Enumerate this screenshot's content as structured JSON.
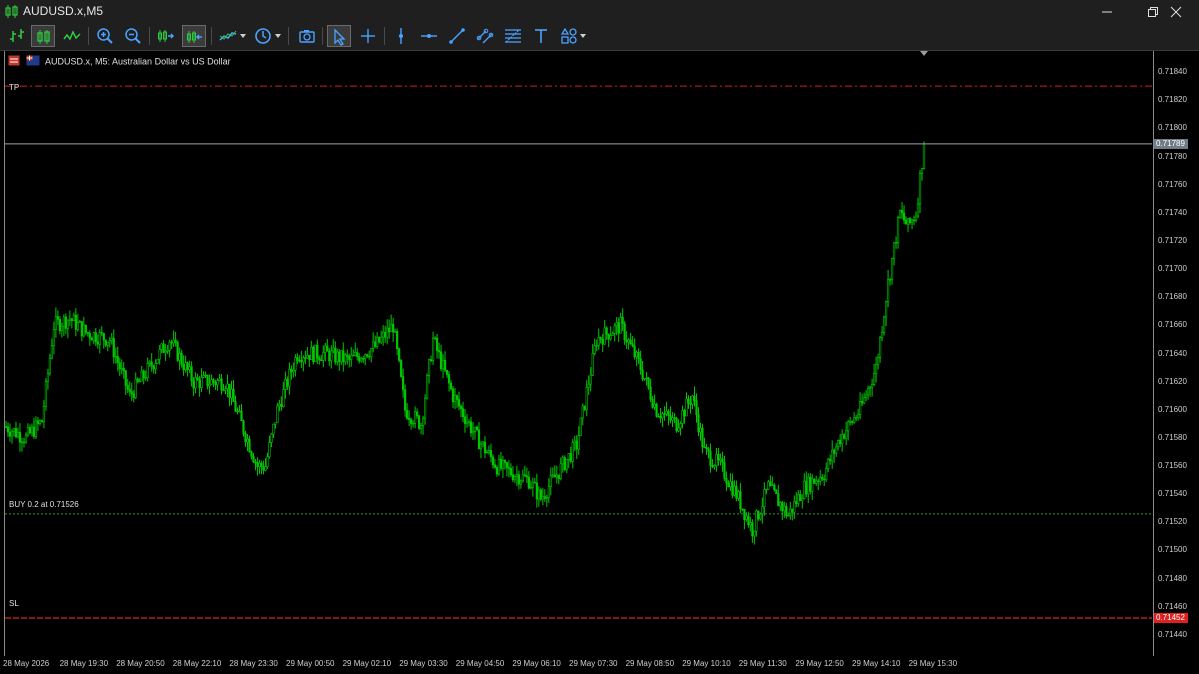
{
  "window": {
    "title": "AUDUSD.x,M5",
    "controls": [
      "minimize-icon",
      "restore-icon",
      "close-icon"
    ]
  },
  "toolbar": {
    "buttons": [
      {
        "name": "bar-chart-button",
        "icon": "bar-chart-icon"
      },
      {
        "name": "candlestick-button",
        "icon": "candlestick-icon",
        "active": true
      },
      {
        "name": "line-chart-button",
        "icon": "line-chart-icon"
      },
      {
        "name": "zoom-in-button",
        "icon": "zoom-in-icon"
      },
      {
        "name": "zoom-out-button",
        "icon": "zoom-out-icon"
      },
      {
        "name": "autoscroll-button",
        "icon": "autoscroll-icon"
      },
      {
        "name": "chart-shift-button",
        "icon": "chart-shift-icon",
        "active": true
      },
      {
        "name": "indicators-button",
        "icon": "indicators-icon",
        "dropdown": true
      },
      {
        "name": "timeframes-button",
        "icon": "clock-icon",
        "dropdown": true
      },
      {
        "name": "screenshot-button",
        "icon": "camera-icon"
      },
      {
        "name": "cursor-button",
        "icon": "cursor-icon",
        "active": true
      },
      {
        "name": "crosshair-button",
        "icon": "crosshair-icon"
      },
      {
        "name": "vertical-line-button",
        "icon": "vertical-line-icon"
      },
      {
        "name": "horizontal-line-button",
        "icon": "horizontal-line-icon"
      },
      {
        "name": "trendline-button",
        "icon": "trendline-icon"
      },
      {
        "name": "equidistant-channel-button",
        "icon": "channel-icon"
      },
      {
        "name": "fibonacci-button",
        "icon": "fibonacci-icon"
      },
      {
        "name": "text-button",
        "icon": "text-icon"
      },
      {
        "name": "shapes-button",
        "icon": "shapes-icon",
        "dropdown": true
      }
    ]
  },
  "chart": {
    "header": "AUDUSD.x, M5:  Australian Dollar vs US Dollar",
    "levels": {
      "tp_label": "TP",
      "buy_label": "BUY 0.2 at 0.71526",
      "sl_label": "SL",
      "current_price": "0.71789",
      "sl_price": "0.71452"
    },
    "colors": {
      "background": "#000000",
      "candle": "#00c800",
      "tp_line": "#d42020",
      "sl_line": "#e02020",
      "buy_line": "#2f9a2f",
      "bid_line": "#9aa4ad",
      "sl_tag": "#e02020",
      "bid_tag": "#6f7d87"
    }
  },
  "chart_data": {
    "type": "candlestick",
    "symbol": "AUDUSD.x",
    "timeframe": "M5",
    "title": "AUDUSD.x, M5:  Australian Dollar vs US Dollar",
    "y_ticks": [
      "0.71840",
      "0.71820",
      "0.71800",
      "0.71780",
      "0.71760",
      "0.71740",
      "0.71720",
      "0.71700",
      "0.71680",
      "0.71660",
      "0.71640",
      "0.71620",
      "0.71600",
      "0.71580",
      "0.71560",
      "0.71540",
      "0.71520",
      "0.71500",
      "0.71480",
      "0.71460",
      "0.71440"
    ],
    "ylim": [
      0.71425,
      0.71855
    ],
    "x_ticks": [
      "28 May 2026",
      "28 May 19:30",
      "28 May 20:50",
      "28 May 22:10",
      "28 May 23:30",
      "29 May 00:50",
      "29 May 02:10",
      "29 May 03:30",
      "29 May 04:50",
      "29 May 06:10",
      "29 May 07:30",
      "29 May 08:50",
      "29 May 10:10",
      "29 May 11:30",
      "29 May 12:50",
      "29 May 14:10",
      "29 May 15:30"
    ],
    "close_path": [
      {
        "bar": 0,
        "price": 0.71588
      },
      {
        "bar": 10,
        "price": 0.7158
      },
      {
        "bar": 18,
        "price": 0.71592
      },
      {
        "bar": 24,
        "price": 0.7166
      },
      {
        "bar": 32,
        "price": 0.71665
      },
      {
        "bar": 40,
        "price": 0.71655
      },
      {
        "bar": 52,
        "price": 0.7165
      },
      {
        "bar": 62,
        "price": 0.7161
      },
      {
        "bar": 72,
        "price": 0.7163
      },
      {
        "bar": 82,
        "price": 0.7165
      },
      {
        "bar": 94,
        "price": 0.7162
      },
      {
        "bar": 110,
        "price": 0.7162
      },
      {
        "bar": 118,
        "price": 0.7159
      },
      {
        "bar": 126,
        "price": 0.7156
      },
      {
        "bar": 130,
        "price": 0.7156
      },
      {
        "bar": 136,
        "price": 0.716
      },
      {
        "bar": 146,
        "price": 0.7164
      },
      {
        "bar": 160,
        "price": 0.7164
      },
      {
        "bar": 172,
        "price": 0.71635
      },
      {
        "bar": 185,
        "price": 0.71645
      },
      {
        "bar": 194,
        "price": 0.7166
      },
      {
        "bar": 200,
        "price": 0.716
      },
      {
        "bar": 208,
        "price": 0.7159
      },
      {
        "bar": 214,
        "price": 0.7165
      },
      {
        "bar": 224,
        "price": 0.7161
      },
      {
        "bar": 236,
        "price": 0.7158
      },
      {
        "bar": 246,
        "price": 0.7156
      },
      {
        "bar": 262,
        "price": 0.7155
      },
      {
        "bar": 268,
        "price": 0.71537
      },
      {
        "bar": 274,
        "price": 0.7155
      },
      {
        "bar": 286,
        "price": 0.71575
      },
      {
        "bar": 296,
        "price": 0.7165
      },
      {
        "bar": 308,
        "price": 0.7166
      },
      {
        "bar": 318,
        "price": 0.7163
      },
      {
        "bar": 326,
        "price": 0.716
      },
      {
        "bar": 336,
        "price": 0.7159
      },
      {
        "bar": 344,
        "price": 0.7161
      },
      {
        "bar": 350,
        "price": 0.7157
      },
      {
        "bar": 358,
        "price": 0.7156
      },
      {
        "bar": 366,
        "price": 0.7154
      },
      {
        "bar": 374,
        "price": 0.71515
      },
      {
        "bar": 382,
        "price": 0.71545
      },
      {
        "bar": 392,
        "price": 0.71525
      },
      {
        "bar": 400,
        "price": 0.71545
      },
      {
        "bar": 410,
        "price": 0.71555
      },
      {
        "bar": 418,
        "price": 0.7158
      },
      {
        "bar": 428,
        "price": 0.716
      },
      {
        "bar": 436,
        "price": 0.7163
      },
      {
        "bar": 442,
        "price": 0.7169
      },
      {
        "bar": 448,
        "price": 0.7174
      },
      {
        "bar": 452,
        "price": 0.7173
      },
      {
        "bar": 456,
        "price": 0.7174
      },
      {
        "bar": 460,
        "price": 0.71789
      }
    ]
  }
}
